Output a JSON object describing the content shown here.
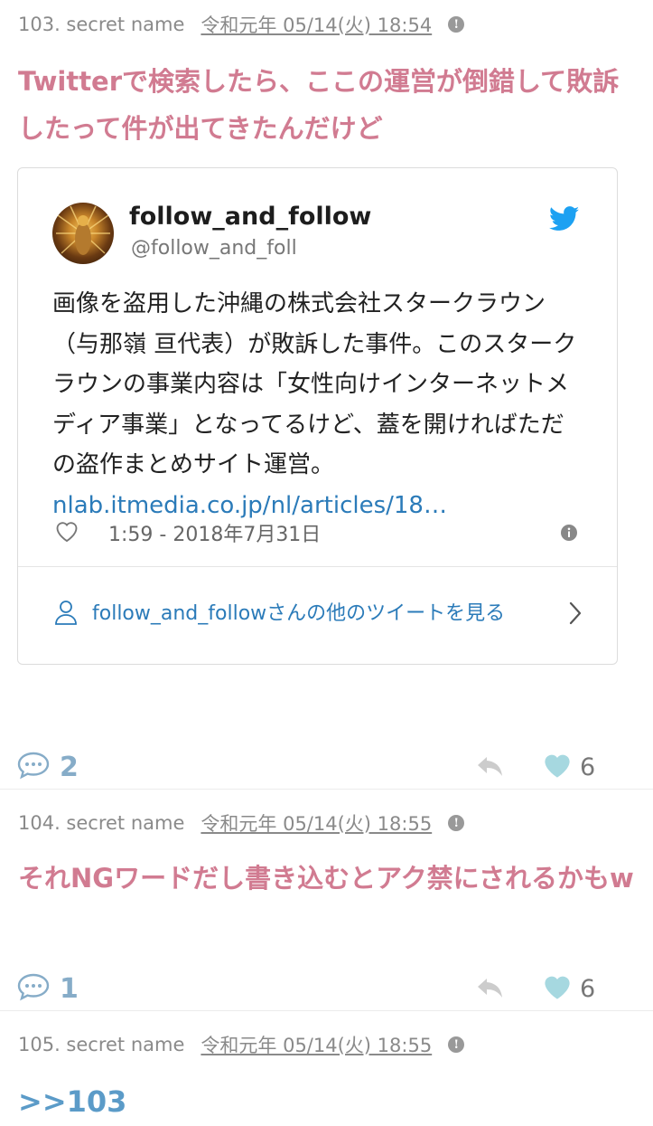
{
  "posts": [
    {
      "number": "103. secret name",
      "date": "令和元年 05/14(火) 18:54",
      "body": "Twitterで検索したら、ここの運営が倒錯して敗訴したって件が出てきたんだけど",
      "comments": "2",
      "likes": "6"
    },
    {
      "number": "104. secret name",
      "date": "令和元年 05/14(火) 18:55",
      "body": "それNGワードだし書き込むとアク禁にされるかもw",
      "comments": "1",
      "likes": "6"
    },
    {
      "number": "105. secret name",
      "date": "令和元年 05/14(火) 18:55",
      "body": ">>103"
    }
  ],
  "tweet": {
    "name": "follow_and_follow",
    "handle": "@follow_and_foll",
    "text": "画像を盗用した沖縄の株式会社スタークラウン（与那嶺 亘代表）が敗訴した事件。このスタークラウンの事業内容は「女性向けインターネットメディア事業」となってるけど、蓋を開ければただの盗作まとめサイト運営。",
    "link": "nlab.itmedia.co.jp/nl/articles/18…",
    "time": "1:59 - 2018年7月31日",
    "more": "follow_and_followさんの他のツイートを見る"
  },
  "colors": {
    "post_body": "#d17b91",
    "anchor": "#5b9bc8",
    "link": "#2b7bb9",
    "comment": "#86acc8",
    "heart": "#a6d8e0"
  }
}
